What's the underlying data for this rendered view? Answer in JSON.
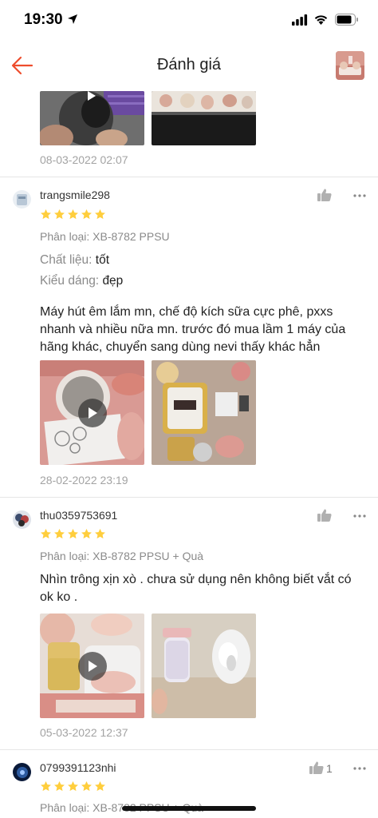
{
  "status_bar": {
    "time": "19:30"
  },
  "header": {
    "title": "Đánh giá"
  },
  "colors": {
    "accent": "#ee4d2d",
    "star": "#ffce3d",
    "muted": "#a3a3a3"
  },
  "top_review": {
    "date": "08-03-2022 02:07"
  },
  "reviews": [
    {
      "username": "trangsmile298",
      "rating": 5,
      "variation": "Phân loại: XB-8782 PPSU",
      "material_label": "Chất liệu:",
      "material_value": "tốt",
      "style_label": "Kiểu dáng:",
      "style_value": "đẹp",
      "text": "Máy hút êm lắm mn, chế độ kích sữa cực phê, pxxs nhanh và nhiều nữa mn. trước đó mua lầm 1 máy của hãng khác, chuyển sang dùng nevi thấy khác hẳn",
      "date": "28-02-2022 23:19"
    },
    {
      "username": "thu0359753691",
      "rating": 5,
      "variation": "Phân loại: XB-8782 PPSU + Quà",
      "text": "Nhìn trông xịn xò . chưa sử dụng nên không biết vắt có ok ko .",
      "date": "05-03-2022 12:37"
    },
    {
      "username": "0799391123nhi",
      "rating": 5,
      "likes": "1",
      "variation": "Phân loại: XB-8782 PPSU + Quà"
    }
  ]
}
